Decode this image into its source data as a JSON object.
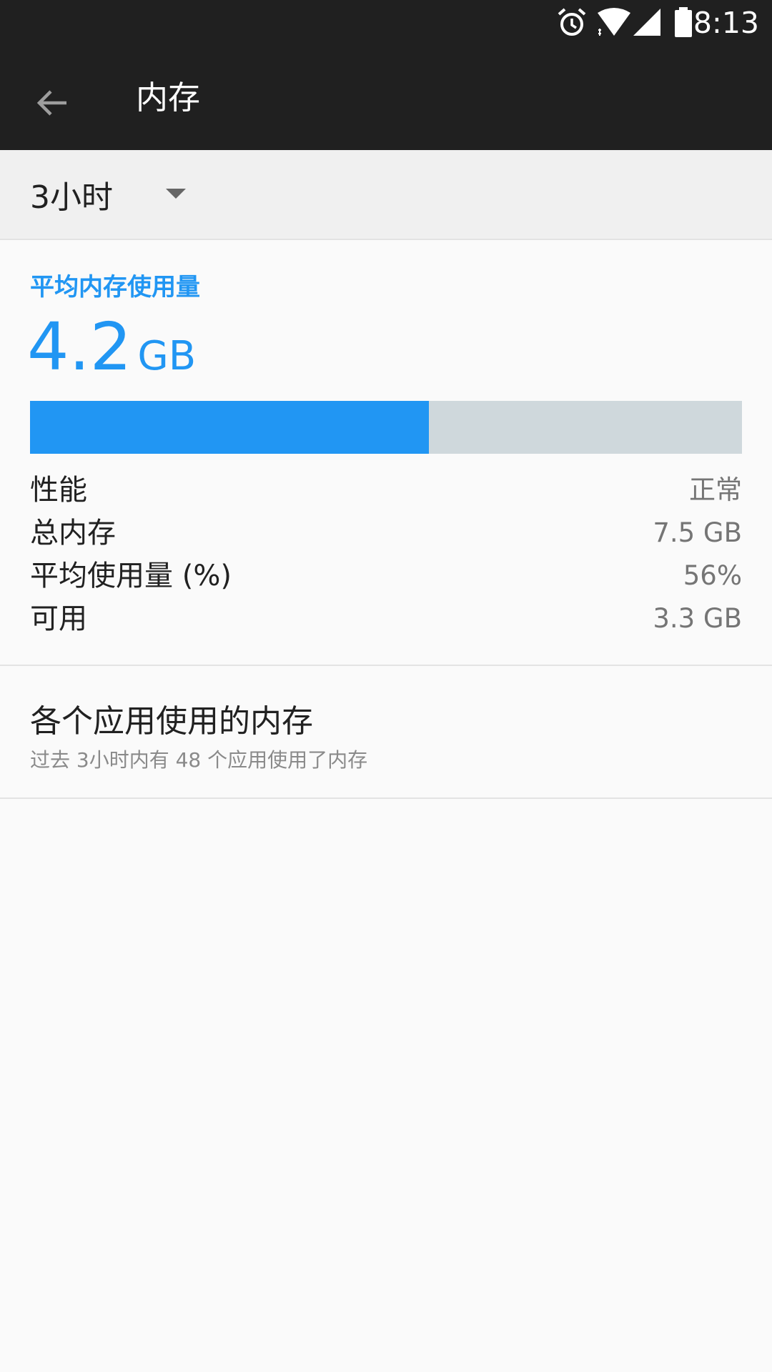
{
  "status_bar": {
    "time": "8:13",
    "icons": [
      "alarm-icon",
      "wifi-icon",
      "signal-icon",
      "battery-icon"
    ]
  },
  "app_bar": {
    "title": "内存",
    "back_icon": "arrow-back-icon"
  },
  "filter": {
    "period": "3小时",
    "dropdown_icon": "caret-down-icon"
  },
  "summary": {
    "label": "平均内存使用量",
    "value": "4.2",
    "unit": "GB",
    "usage_fraction": 0.56,
    "colors": {
      "accent": "#2196f3",
      "track": "#cfd8dc"
    }
  },
  "stats": [
    {
      "label": "性能",
      "value": "正常"
    },
    {
      "label": "总内存",
      "value": "7.5 GB"
    },
    {
      "label": "平均使用量 (%)",
      "value": "56%"
    },
    {
      "label": "可用",
      "value": "3.3 GB"
    }
  ],
  "app_memory": {
    "title": "各个应用使用的内存",
    "subtitle": "过去 3小时内有 48 个应用使用了内存"
  }
}
